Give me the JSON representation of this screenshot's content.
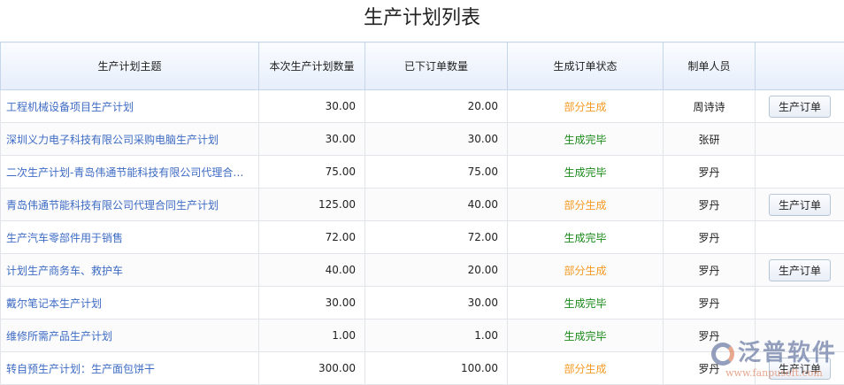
{
  "title": "生产计划列表",
  "columns": [
    "生产计划主题",
    "本次生产计划数量",
    "已下订单数量",
    "生成订单状态",
    "制单人员",
    ""
  ],
  "colors": {
    "partial": "#f59a23",
    "done": "#1a8a1a",
    "link": "#3d6bc4"
  },
  "rows": [
    {
      "subject": "工程机械设备项目生产计划",
      "plan_qty": "30.00",
      "ordered_qty": "20.00",
      "status": "部分生成",
      "status_type": "partial",
      "creator": "周诗诗",
      "action": "生产订单"
    },
    {
      "subject": "深圳义力电子科技有限公司采购电脑生产计划",
      "plan_qty": "30.00",
      "ordered_qty": "30.00",
      "status": "生成完毕",
      "status_type": "done",
      "creator": "张研",
      "action": null
    },
    {
      "subject": "二次生产计划-青岛伟通节能科技有限公司代理合同生产计划",
      "plan_qty": "75.00",
      "ordered_qty": "75.00",
      "status": "生成完毕",
      "status_type": "done",
      "creator": "罗丹",
      "action": null
    },
    {
      "subject": "青岛伟通节能科技有限公司代理合同生产计划",
      "plan_qty": "125.00",
      "ordered_qty": "40.00",
      "status": "部分生成",
      "status_type": "partial",
      "creator": "罗丹",
      "action": "生产订单"
    },
    {
      "subject": "生产汽车零部件用于销售",
      "plan_qty": "72.00",
      "ordered_qty": "72.00",
      "status": "生成完毕",
      "status_type": "done",
      "creator": "罗丹",
      "action": null
    },
    {
      "subject": "计划生产商务车、救护车",
      "plan_qty": "40.00",
      "ordered_qty": "20.00",
      "status": "部分生成",
      "status_type": "partial",
      "creator": "罗丹",
      "action": "生产订单"
    },
    {
      "subject": "戴尔笔记本生产计划",
      "plan_qty": "30.00",
      "ordered_qty": "30.00",
      "status": "生成完毕",
      "status_type": "done",
      "creator": "罗丹",
      "action": null
    },
    {
      "subject": "维修所需产品生产计划",
      "plan_qty": "1.00",
      "ordered_qty": "1.00",
      "status": "生成完毕",
      "status_type": "done",
      "creator": "罗丹",
      "action": null
    },
    {
      "subject": "转自预生产计划：生产面包饼干",
      "plan_qty": "300.00",
      "ordered_qty": "100.00",
      "status": "部分生成",
      "status_type": "partial",
      "creator": "罗丹",
      "action": "生产订单"
    }
  ],
  "watermark": {
    "brand": "泛普软件",
    "url": "www.fanpusoft.com"
  }
}
